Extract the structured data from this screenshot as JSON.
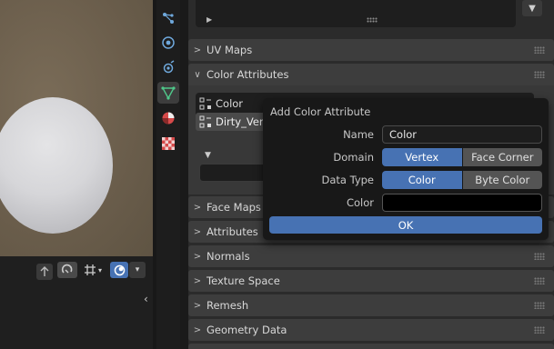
{
  "viewport": {
    "header_buttons": [
      "arrow-icon",
      "snap-icon",
      "transform-pivot-icon",
      "overlay-icon"
    ]
  },
  "tabs": [
    {
      "name": "particles-tab",
      "icon": "modifier-graph-icon"
    },
    {
      "name": "physics-tab",
      "icon": "physics-icon"
    },
    {
      "name": "constraints-tab",
      "icon": "constraint-icon"
    },
    {
      "name": "data-tab",
      "icon": "vertex-data-icon",
      "active": true
    },
    {
      "name": "material-tab",
      "icon": "material-sphere-icon"
    },
    {
      "name": "texture-tab",
      "icon": "checker-icon"
    }
  ],
  "panels": {
    "uv_maps": "UV Maps",
    "color_attributes": "Color Attributes",
    "face_maps": "Face Maps",
    "attributes": "Attributes",
    "normals": "Normals",
    "texture_space": "Texture Space",
    "remesh": "Remesh",
    "geometry_data": "Geometry Data"
  },
  "color_attributes_list": [
    {
      "label": "Color",
      "selected": false
    },
    {
      "label": "Dirty_Ver",
      "selected": true
    }
  ],
  "popup": {
    "title": "Add Color Attribute",
    "name_label": "Name",
    "name_value": "Color",
    "domain_label": "Domain",
    "domain_options": [
      "Vertex",
      "Face Corner"
    ],
    "domain_selected": "Vertex",
    "data_type_label": "Data Type",
    "data_type_options": [
      "Color",
      "Byte Color"
    ],
    "data_type_selected": "Color",
    "color_label": "Color",
    "color_value": "#000000",
    "ok_label": "OK"
  },
  "colors": {
    "accent": "#4772b3",
    "panel": "#3d3d3d",
    "popup_bg": "#181818"
  }
}
